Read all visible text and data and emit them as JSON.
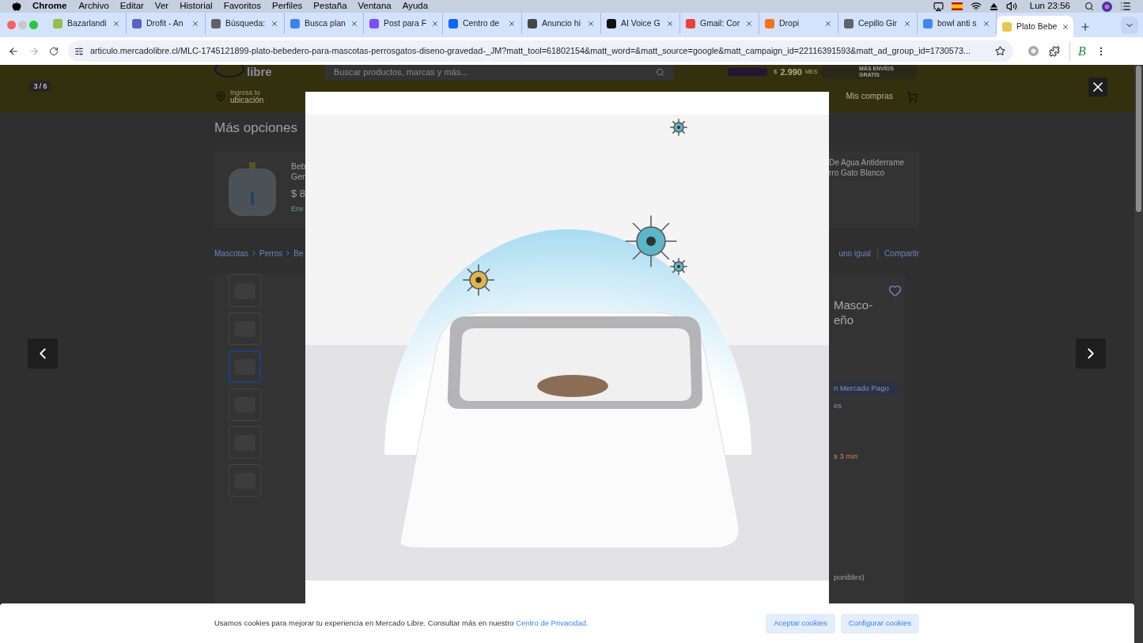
{
  "menubar": {
    "app": "Chrome",
    "items": [
      "Archivo",
      "Editar",
      "Ver",
      "Historial",
      "Favoritos",
      "Perfiles",
      "Pestaña",
      "Ventana",
      "Ayuda"
    ],
    "clock": "Lun 23:56"
  },
  "tabs": [
    {
      "label": "Bazarlandi",
      "selected": false,
      "color": "#95bf47"
    },
    {
      "label": "Drofit - An",
      "selected": false,
      "color": "#5b5fc7"
    },
    {
      "label": "Búsqueda:",
      "selected": false,
      "color": "#5f6368"
    },
    {
      "label": "Busca plan",
      "selected": false,
      "color": "#3b82f6"
    },
    {
      "label": "Post para F",
      "selected": false,
      "color": "#7c4dff"
    },
    {
      "label": "Centro de",
      "selected": false,
      "color": "#0866ff"
    },
    {
      "label": "Anuncio hi",
      "selected": false,
      "color": "#444746"
    },
    {
      "label": "AI Voice G",
      "selected": false,
      "color": "#111111"
    },
    {
      "label": "Gmail: Cor",
      "selected": false,
      "color": "#ea4335"
    },
    {
      "label": "Dropi",
      "selected": false,
      "color": "#f97316"
    },
    {
      "label": "Cepillo Gir",
      "selected": false,
      "color": "#5f6368"
    },
    {
      "label": "bowl anti s",
      "selected": false,
      "color": "#4285f4"
    },
    {
      "label": "Plato Bebe",
      "selected": true,
      "color": "#e6c84a"
    }
  ],
  "addressbar": {
    "url": "articulo.mercadolibre.cl/MLC-1745121899-plato-bebedero-para-mascotas-perrosgatos-diseno-gravedad-_JM?matt_tool=61802154&matt_word=&matt_source=google&matt_campaign_id=22116391593&matt_ad_group_id=1730573...",
    "forward_disabled": true,
    "profile": "B"
  },
  "page": {
    "header": {
      "logo_text": "libre",
      "search_placeholder": "Buscar productos, marcas y más...",
      "promo_currency": "$",
      "promo_price": "2.990",
      "promo_unit": "MES",
      "promo_text": "MÁS ENVÍOS GRATIS",
      "location": [
        "Ingresa tu",
        "ubicación"
      ],
      "my_purchases": "Mis compras"
    },
    "more_options": {
      "title": "Más opciones",
      "cards": [
        {
          "lines": [
            "Beb",
            "Gen"
          ],
          "price": "$ 8",
          "shipping": "Env"
        },
        {
          "lines": [
            "De Agua Antiderrame",
            "rro Gato Blanco"
          ]
        }
      ]
    },
    "breadcrumbs": [
      "Mascotas",
      "Perros",
      "Be"
    ],
    "actions": [
      "uno igual",
      "Compartir"
    ],
    "thumbnails": [
      {
        "selected": false
      },
      {
        "selected": false
      },
      {
        "selected": true
      },
      {
        "selected": false
      },
      {
        "selected": false
      },
      {
        "selected": false
      }
    ],
    "product": {
      "title": [
        "Masco-",
        "eño"
      ],
      "payment_chip": "n Mercado Pago",
      "line": "es",
      "delivery": "s",
      "delivery_time": "3 min",
      "stock": "ponibles)"
    }
  },
  "gallery": {
    "counter": "3 / 6"
  },
  "cookies": {
    "text": "Usamos cookies para mejorar tu experiencia en Mercado Libre. Consultar más en nuestro",
    "link": "Centro de Privacidad.",
    "buttons": [
      "Aceptar cookies",
      "Configurar cookies"
    ]
  }
}
